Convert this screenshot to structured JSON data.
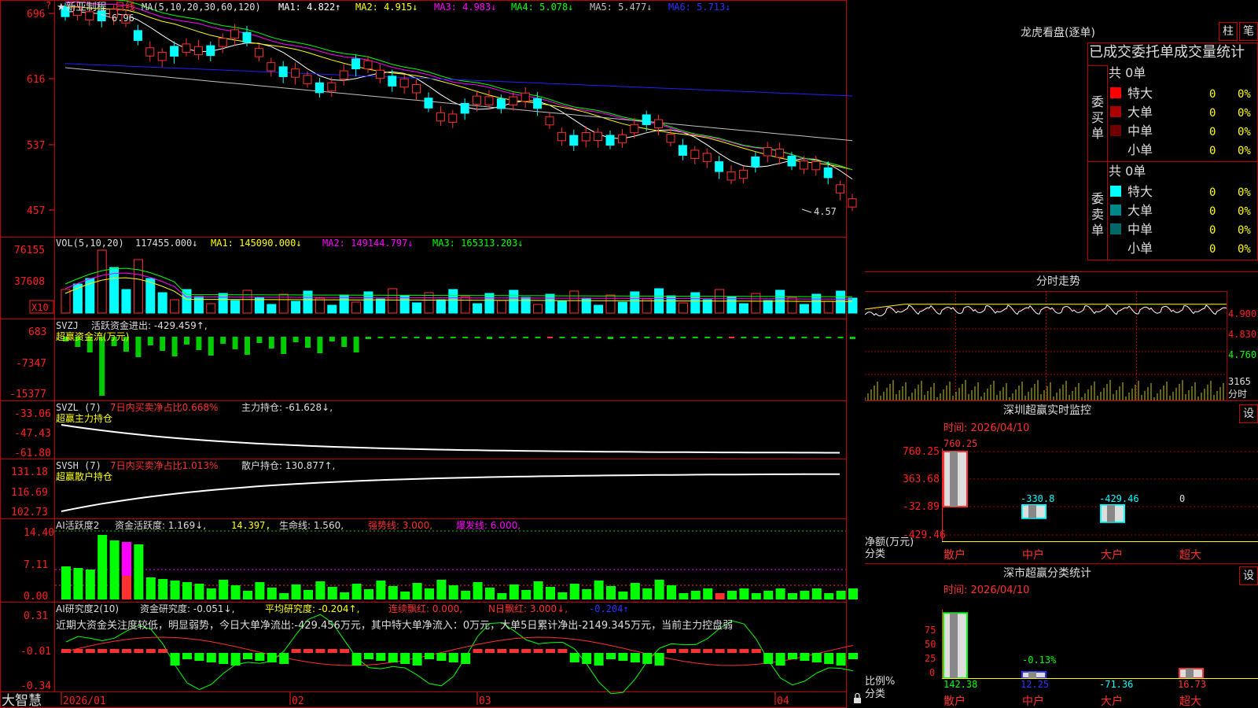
{
  "app": {
    "title": "大智慧"
  },
  "stock": {
    "name": "★新亚制程",
    "period": "日线"
  },
  "colors": {
    "up": "#ff3030",
    "down": "#00ffff",
    "grid": "#aa0000",
    "axis": "#ff2020",
    "ma1": "#ffffff",
    "ma2": "#ffff00",
    "ma3": "#ff00ff",
    "ma4": "#00ff00",
    "ma5": "#c0c0c0",
    "ma6": "#2020ff"
  },
  "main_panel": {
    "header": [
      "MA(5,10,20,30,60,120)",
      "MA1: 4.822↑",
      "MA2: 4.915↓",
      "MA3: 4.983↓",
      "MA4: 5.078↓",
      "MA5: 5.477↓",
      "MA6: 5.713↓"
    ],
    "y_ticks": [
      "696",
      "616",
      "537",
      "457"
    ],
    "high_label": "6.96",
    "low_label": "4.57"
  },
  "vol_panel": {
    "header": [
      "VOL(5,10,20)",
      "117455.000↓",
      "MA1: 145090.000↓",
      "MA2: 149144.797↓",
      "MA3: 165313.203↓"
    ],
    "y_ticks": [
      "76155",
      "37608"
    ],
    "unit": "X10"
  },
  "svzj_panel": {
    "header": [
      "SVZJ",
      "活跃资金进出: -429.459↑,"
    ],
    "subtitle": "超赢资金流(万元)",
    "y_ticks": [
      "683",
      "-7347",
      "-15377"
    ]
  },
  "svzl_panel": {
    "header": [
      "SVZL (7)",
      "7日内买卖净占比0.668%",
      "主力持仓: -61.628↓,"
    ],
    "subtitle": "超赢主力持仓",
    "y_ticks": [
      "-33.06",
      "-47.43",
      "-61.80"
    ]
  },
  "svsh_panel": {
    "header": [
      "SVSH (7)",
      "7日内买卖净占比1.013%",
      "散户持仓: 130.877↑,"
    ],
    "subtitle": "超赢散户持仓",
    "y_ticks": [
      "131.18",
      "116.69",
      "102.73"
    ]
  },
  "ai_active_panel": {
    "header": [
      "AI活跃度2",
      "资金活跃度: 1.169↓,",
      "14.397,",
      "生命线: 1.560,",
      "强势线: 3.000,",
      "爆发线: 6.000,"
    ],
    "y_ticks": [
      "14.40",
      "7.11",
      "0.00"
    ]
  },
  "ai_research_panel": {
    "header": [
      "AI研究度2(10)",
      "资金研究度: -0.051↓,",
      "平均研究度: -0.204↑,",
      "连续飘红: 0.000,",
      "N日飘红: 3.000↓,",
      "-0.204↑"
    ],
    "comment": "近期大资金关注度较低，明显弱势，今日大单净流出:-429.456万元，其中特大单净流入：0万元，大单5日累计净出-2149.345万元，当前主力控盘弱",
    "y_ticks": [
      "0.31",
      "-0.01",
      "-0.34"
    ]
  },
  "x_axis": {
    "labels": [
      "2026/01",
      "02",
      "03",
      "04"
    ]
  },
  "dragon_tiger": {
    "title": "龙虎看盘(逐单)",
    "btn_bar": "柱",
    "btn_pen": "笔",
    "tabs": "已成交委托单成交量统计",
    "buy": {
      "label": "委买单",
      "total": "共 0单",
      "rows": [
        {
          "name": "特大",
          "value": "0",
          "pct": "0%",
          "color": "#ff0000"
        },
        {
          "name": "大单",
          "value": "0",
          "pct": "0%",
          "color": "#aa0000"
        },
        {
          "name": "中单",
          "value": "0",
          "pct": "0%",
          "color": "#700000"
        },
        {
          "name": "小单",
          "value": "0",
          "pct": "0%",
          "color": "#000000"
        }
      ]
    },
    "sell": {
      "label": "委卖单",
      "total": "共 0单",
      "rows": [
        {
          "name": "特大",
          "value": "0",
          "pct": "0%",
          "color": "#00ffff"
        },
        {
          "name": "大单",
          "value": "0",
          "pct": "0%",
          "color": "#008888"
        },
        {
          "name": "中单",
          "value": "0",
          "pct": "0%",
          "color": "#006666"
        },
        {
          "name": "小单",
          "value": "0",
          "pct": "0%",
          "color": "#000000"
        }
      ]
    }
  },
  "intraday": {
    "title": "分时走势",
    "prices": [
      "4.900",
      "4.830",
      "4.760"
    ],
    "vol_max": "3165",
    "vol_label": "分时"
  },
  "sz_monitor": {
    "title": "深圳超赢实时监控",
    "btn": "设",
    "time": "时间: 2026/04/10",
    "y_ticks": [
      "760.25",
      "363.68",
      "-32.89",
      "-429.46"
    ],
    "y_label": "净额(万元)",
    "x_label": "分类",
    "categories": [
      "散户",
      "中户",
      "大户",
      "超大"
    ],
    "values": [
      760.25,
      -330.8,
      -429.46,
      0
    ],
    "value_labels": [
      "760.25",
      "-330.8",
      "-429.46",
      "0"
    ]
  },
  "sz_class": {
    "title": "深市超赢分类统计",
    "btn": "设",
    "time": "时间: 2026/04/10",
    "y_ticks": [
      "75",
      "50",
      "25",
      "0"
    ],
    "y_label": "比例%",
    "x_label": "分类",
    "categories": [
      "散户",
      "中户",
      "大户",
      "超大"
    ],
    "values": [
      142.38,
      12.25,
      -71.36,
      16.73
    ],
    "value_labels": [
      "142.38",
      "12.25",
      "-71.36",
      "16.73"
    ],
    "extra_label": "-0.13%"
  }
}
